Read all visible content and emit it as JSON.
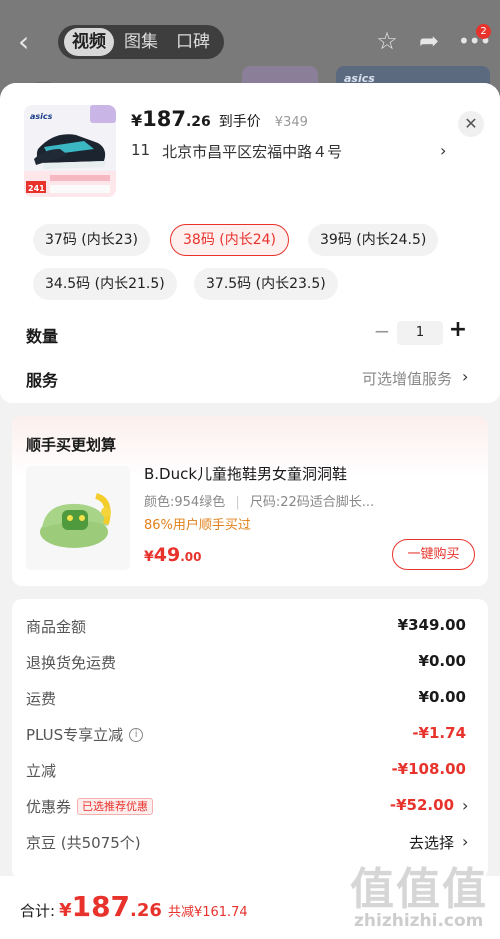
{
  "nav": {
    "tabs": [
      "视频",
      "图集",
      "口碑"
    ],
    "badge_count": "2",
    "brand_logo": "asics"
  },
  "product": {
    "price_symbol": "¥",
    "price_int": "187",
    "price_dec": ".26",
    "price_label": "到手价",
    "original_price": "¥349",
    "address_prefix": "11",
    "address": "北京市昌平区宏福中路４号",
    "thumb_brand": "asics",
    "thumb_price_tag": "241"
  },
  "sizes": [
    {
      "label": "37码 (内长23)",
      "selected": false
    },
    {
      "label": "38码 (内长24)",
      "selected": true
    },
    {
      "label": "39码 (内长24.5)",
      "selected": false
    },
    {
      "label": "34.5码 (内长21.5)",
      "selected": false
    },
    {
      "label": "37.5码 (内长23.5)",
      "selected": false
    }
  ],
  "quantity": {
    "label": "数量",
    "value": "1",
    "minus": "−",
    "plus": "+"
  },
  "service": {
    "label": "服务",
    "value": "可选增值服务"
  },
  "combo": {
    "title": "顺手买更划算",
    "name": "B.Duck儿童拖鞋男女童洞洞鞋",
    "spec_color": "颜色:954绿色",
    "spec_size": "尺码:22码适合脚长...",
    "rate": "86%用户顺手买过",
    "price_symbol": "¥",
    "price_int": "49",
    "price_dec": ".00",
    "button": "一键购买"
  },
  "summary": [
    {
      "label": "商品金额",
      "value": "¥349.00",
      "style": "normal"
    },
    {
      "label": "退换货免运费",
      "value": "¥0.00",
      "style": "normal"
    },
    {
      "label": "运费",
      "value": "¥0.00",
      "style": "normal"
    },
    {
      "label": "PLUS专享立减",
      "value": "-¥1.74",
      "style": "red",
      "info": "i"
    },
    {
      "label": "立减",
      "value": "-¥108.00",
      "style": "red"
    },
    {
      "label": "优惠券",
      "value": "-¥52.00",
      "style": "red",
      "tag": "已选推荐优惠"
    },
    {
      "label": "京豆 (共5075个)",
      "value": "去选择",
      "style": "plain"
    }
  ],
  "total": {
    "label": "合计:",
    "symbol": "¥",
    "int": "187",
    "dec": ".26",
    "saving": "共减¥161.74"
  },
  "watermark": {
    "glyphs": "值值值",
    "text": "zhizhizhi.com"
  },
  "colors": {
    "accent": "#e8332d",
    "orange": "#e0801a"
  }
}
